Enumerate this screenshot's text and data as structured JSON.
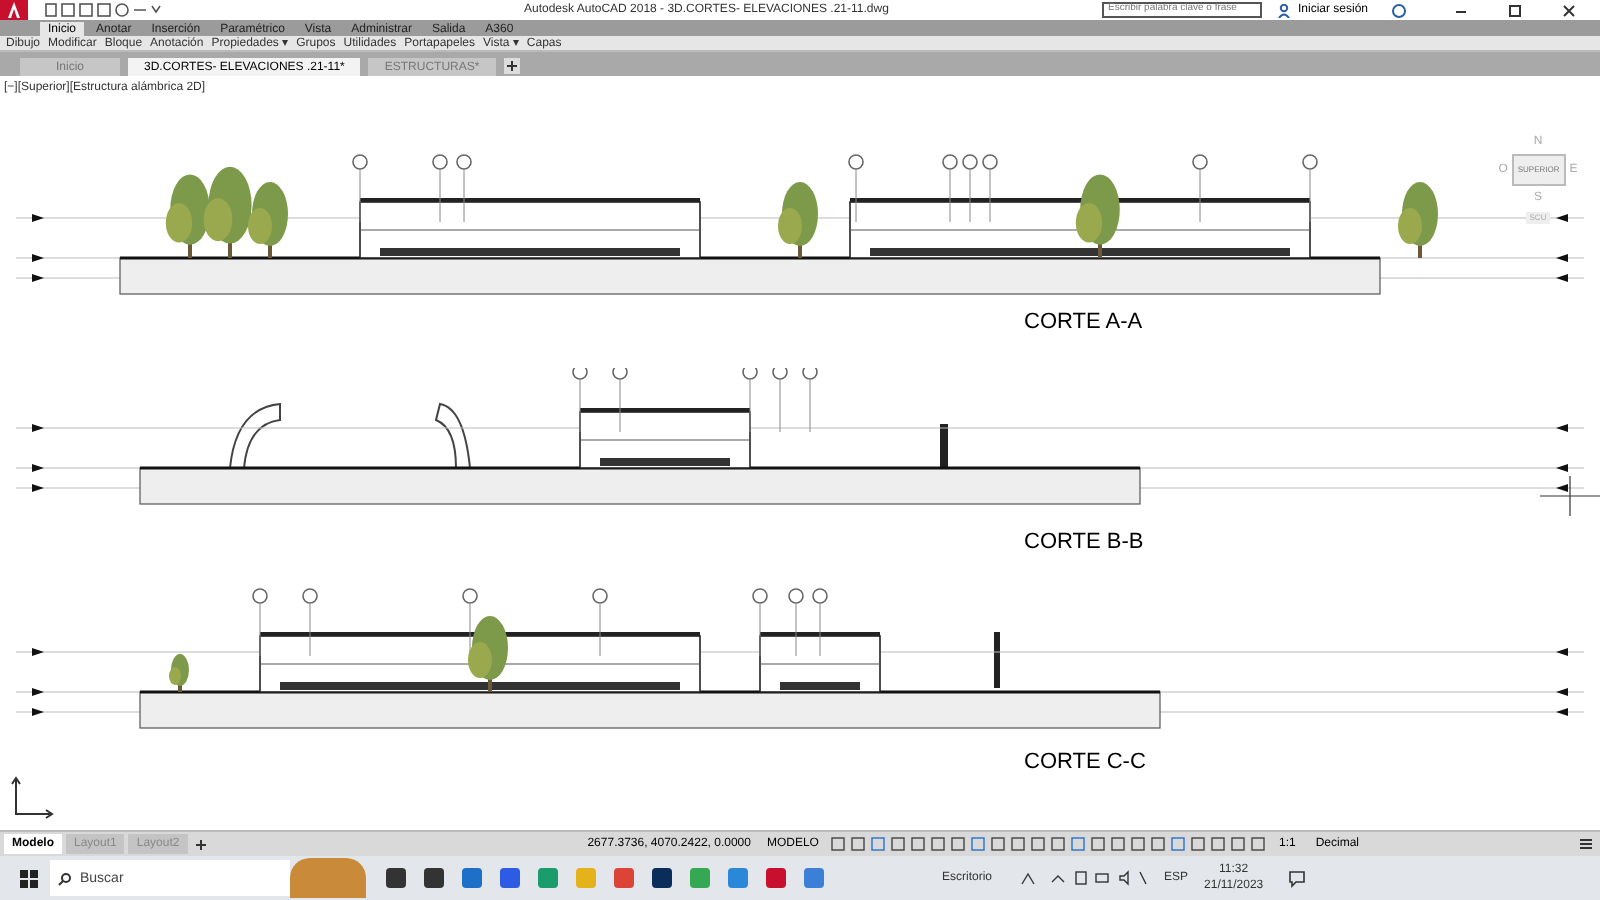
{
  "window": {
    "title": "Autodesk AutoCAD 2018    - 3D.CORTES- ELEVACIONES .21-11.dwg"
  },
  "search": {
    "placeholder": "Escribir palabra clave o frase"
  },
  "signin": "Iniciar sesión",
  "ribbon_tabs": [
    {
      "label": "Inicio",
      "selected": true
    },
    {
      "label": "Anotar",
      "selected": false
    },
    {
      "label": "Inserción",
      "selected": false
    },
    {
      "label": "Paramétrico",
      "selected": false
    },
    {
      "label": "Vista",
      "selected": false
    },
    {
      "label": "Administrar",
      "selected": false
    },
    {
      "label": "Salida",
      "selected": false
    },
    {
      "label": "A360",
      "selected": false
    }
  ],
  "panels": [
    "Dibujo",
    "Modificar",
    "Bloque",
    "Anotación",
    "Propiedades ▾",
    "Grupos",
    "Utilidades",
    "Portapapeles",
    "Vista ▾",
    "Capas"
  ],
  "file_tabs": [
    {
      "label": "Inicio",
      "selected": false
    },
    {
      "label": "3D.CORTES- ELEVACIONES .21-11*",
      "selected": true
    },
    {
      "label": "ESTRUCTURAS*",
      "selected": false
    }
  ],
  "viewport_label": "[−][Superior][Estructura alámbrica 2D]",
  "viewcube": {
    "north": "N",
    "south": "S",
    "east": "E",
    "west": "O",
    "face": "SUPERIOR",
    "ucs": "SCU"
  },
  "sections": [
    {
      "kind": "a",
      "label": "CORTE A-A"
    },
    {
      "kind": "b",
      "label": "CORTE B-B"
    },
    {
      "kind": "c",
      "label": "CORTE C-C"
    }
  ],
  "layout_tabs": [
    {
      "label": "Modelo",
      "selected": true
    },
    {
      "label": "Layout1",
      "selected": false
    },
    {
      "label": "Layout2",
      "selected": false
    }
  ],
  "status": {
    "coordinates": "2677.3736, 4070.2422, 0.0000",
    "space": "MODELO",
    "scale": "1:1",
    "units": "Decimal"
  },
  "taskbar": {
    "search": "Buscar",
    "desktop": "Escritorio",
    "language": "ESP",
    "time": "11:32",
    "date": "21/11/2023"
  }
}
